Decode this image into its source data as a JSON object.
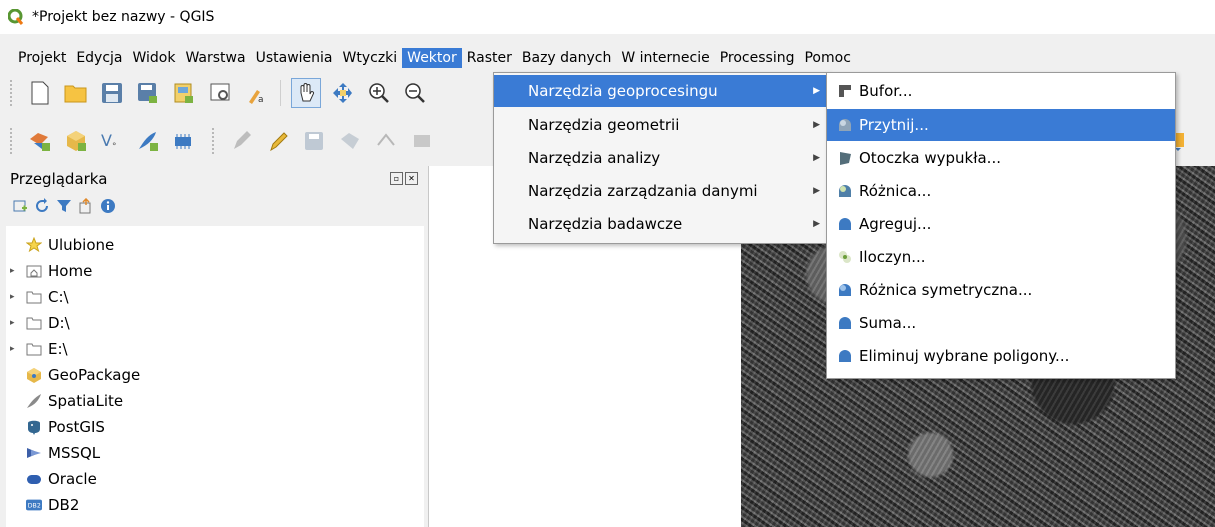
{
  "window": {
    "title": "*Projekt bez nazwy - QGIS"
  },
  "menubar": {
    "items": [
      "Projekt",
      "Edycja",
      "Widok",
      "Warstwa",
      "Ustawienia",
      "Wtyczki",
      "Wektor",
      "Raster",
      "Bazy danych",
      "W internecie",
      "Processing",
      "Pomoc"
    ],
    "active": "Wektor"
  },
  "browser": {
    "title": "Przeglądarka",
    "items": [
      {
        "label": "Ulubione",
        "icon": "star-icon"
      },
      {
        "label": "Home",
        "icon": "home-folder-icon"
      },
      {
        "label": "C:\\",
        "icon": "folder-icon"
      },
      {
        "label": "D:\\",
        "icon": "folder-icon"
      },
      {
        "label": "E:\\",
        "icon": "folder-icon"
      },
      {
        "label": "GeoPackage",
        "icon": "geopackage-icon"
      },
      {
        "label": "SpatiaLite",
        "icon": "spatialite-icon"
      },
      {
        "label": "PostGIS",
        "icon": "postgis-icon"
      },
      {
        "label": "MSSQL",
        "icon": "mssql-icon"
      },
      {
        "label": "Oracle",
        "icon": "oracle-icon"
      },
      {
        "label": "DB2",
        "icon": "db2-icon"
      }
    ]
  },
  "vector_menu": {
    "items": [
      "Narzędzia geoprocesingu",
      "Narzędzia geometrii",
      "Narzędzia analizy",
      "Narzędzia zarządzania danymi",
      "Narzędzia badawcze"
    ],
    "highlighted": "Narzędzia geoprocesingu"
  },
  "geoprocessing_menu": {
    "items": [
      "Bufor...",
      "Przytnij...",
      "Otoczka wypukła...",
      "Różnica...",
      "Agreguj...",
      "Iloczyn...",
      "Różnica symetryczna...",
      "Suma...",
      "Eliminuj wybrane poligony..."
    ],
    "highlighted": "Przytnij..."
  },
  "colors": {
    "highlight": "#3a7bd5",
    "qgis_green": "#589632"
  }
}
